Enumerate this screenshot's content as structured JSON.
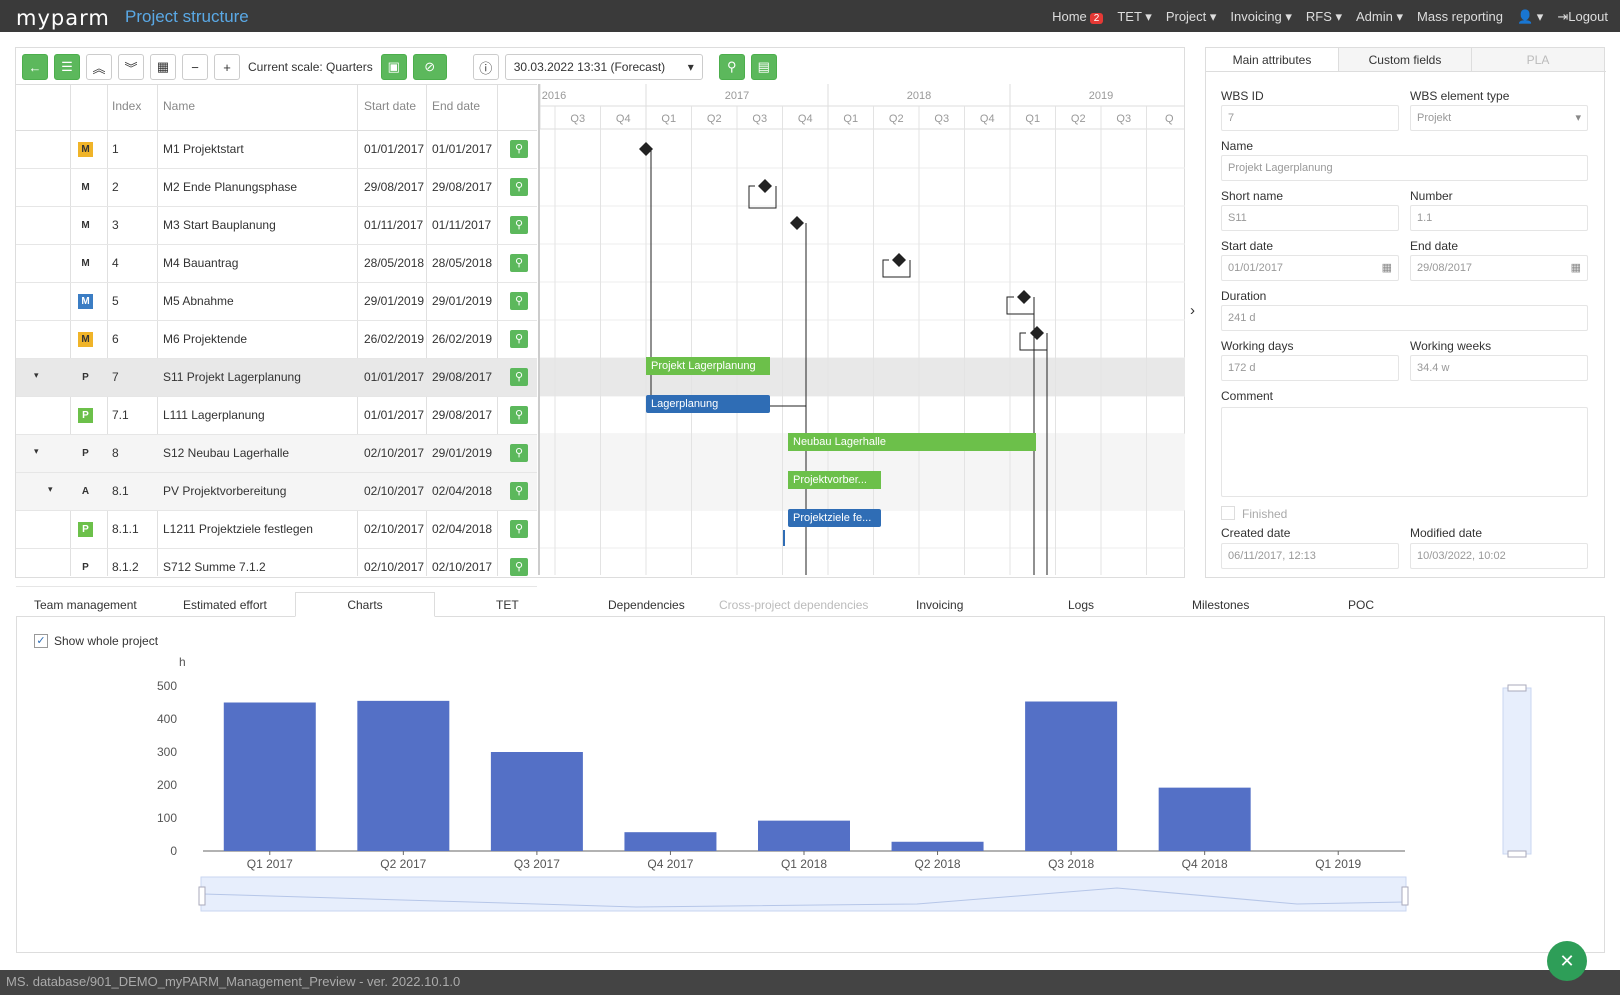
{
  "app": {
    "logo": "myparm",
    "title": "Project structure"
  },
  "nav": {
    "home": "Home",
    "home_badge": "2",
    "tet": "TET",
    "project": "Project",
    "invoicing": "Invoicing",
    "rfs": "RFS",
    "admin": "Admin",
    "mass_reporting": "Mass reporting",
    "logout": "Logout"
  },
  "toolbar": {
    "scale_label": "Current scale: Quarters",
    "forecast_value": "30.03.2022 13:31 (Forecast)"
  },
  "grid": {
    "headers": {
      "index": "Index",
      "name": "Name",
      "start": "Start date",
      "end": "End date"
    },
    "rows": [
      {
        "type": "M",
        "color": "y",
        "index": "1",
        "name": "M1 Projektstart",
        "start": "01/01/2017",
        "end": "01/01/2017",
        "expander": ""
      },
      {
        "type": "M",
        "color": "",
        "index": "2",
        "name": "M2 Ende Planungsphase",
        "start": "29/08/2017",
        "end": "29/08/2017",
        "expander": ""
      },
      {
        "type": "M",
        "color": "",
        "index": "3",
        "name": "M3 Start Bauplanung",
        "start": "01/11/2017",
        "end": "01/11/2017",
        "expander": ""
      },
      {
        "type": "M",
        "color": "",
        "index": "4",
        "name": "M4 Bauantrag",
        "start": "28/05/2018",
        "end": "28/05/2018",
        "expander": ""
      },
      {
        "type": "M",
        "color": "b",
        "index": "5",
        "name": "M5 Abnahme",
        "start": "29/01/2019",
        "end": "29/01/2019",
        "expander": ""
      },
      {
        "type": "M",
        "color": "y",
        "index": "6",
        "name": "M6 Projektende",
        "start": "26/02/2019",
        "end": "26/02/2019",
        "expander": ""
      },
      {
        "type": "P",
        "color": "",
        "index": "7",
        "name": "S11 Projekt Lagerplanung",
        "start": "01/01/2017",
        "end": "29/08/2017",
        "expander": "▾"
      },
      {
        "type": "P",
        "color": "g",
        "index": "7.1",
        "name": "L111 Lagerplanung",
        "start": "01/01/2017",
        "end": "29/08/2017",
        "expander": ""
      },
      {
        "type": "P",
        "color": "",
        "index": "8",
        "name": "S12 Neubau Lagerhalle",
        "start": "02/10/2017",
        "end": "29/01/2019",
        "expander": "▾"
      },
      {
        "type": "A",
        "color": "",
        "index": "8.1",
        "name": "PV Projektvorbereitung",
        "start": "02/10/2017",
        "end": "02/04/2018",
        "expander": "▾"
      },
      {
        "type": "P",
        "color": "g",
        "index": "8.1.1",
        "name": "L1211 Projektziele festlegen",
        "start": "02/10/2017",
        "end": "02/04/2018",
        "expander": ""
      },
      {
        "type": "P",
        "color": "",
        "index": "8.1.2",
        "name": "S712 Summe 7.1.2",
        "start": "02/10/2017",
        "end": "02/10/2017",
        "expander": ""
      }
    ]
  },
  "gantt": {
    "years": [
      "2016",
      "2017",
      "2018",
      "2019"
    ],
    "quarters": [
      "Q3",
      "Q4",
      "Q1",
      "Q2",
      "Q3",
      "Q4",
      "Q1",
      "Q2",
      "Q3",
      "Q4",
      "Q1",
      "Q2",
      "Q3",
      "Q"
    ],
    "bars": {
      "b1": "Projekt Lagerplanung",
      "b2": "Lagerplanung",
      "b3": "Neubau Lagerhalle",
      "b4": "Projektvorber...",
      "b5": "Projektziele fe..."
    }
  },
  "side": {
    "tabs": [
      "Main attributes",
      "Custom fields",
      "PLA"
    ],
    "wbs_id_label": "WBS ID",
    "wbs_id": "7",
    "type_label": "WBS element type",
    "type": "Projekt",
    "name_label": "Name",
    "name": "Projekt Lagerplanung",
    "short_label": "Short name",
    "short": "S11",
    "number_label": "Number",
    "number": "1.1",
    "start_label": "Start date",
    "start": "01/01/2017",
    "end_label": "End date",
    "end": "29/08/2017",
    "duration_label": "Duration",
    "duration": "241 d",
    "wdays_label": "Working days",
    "wdays": "172 d",
    "wweeks_label": "Working weeks",
    "wweeks": "34.4 w",
    "comment_label": "Comment",
    "finished_label": "Finished",
    "created_label": "Created date",
    "created": "06/11/2017, 12:13",
    "modified_label": "Modified date",
    "modified": "10/03/2022, 10:02"
  },
  "bottom_tabs": [
    "Team management",
    "Estimated effort",
    "Charts",
    "TET",
    "Dependencies",
    "Cross-project dependencies",
    "Invoicing",
    "Logs",
    "Milestones",
    "POC"
  ],
  "show_whole_label": "Show whole project",
  "status_text": "MS. database/901_DEMO_myPARM_Management_Preview - ver. 2022.10.1.0",
  "chart_data": {
    "type": "bar",
    "categories": [
      "Q1 2017",
      "Q2 2017",
      "Q3 2017",
      "Q4 2017",
      "Q1 2018",
      "Q2 2018",
      "Q3 2018",
      "Q4 2018",
      "Q1 2019"
    ],
    "values": [
      450,
      455,
      300,
      57,
      92,
      28,
      453,
      192,
      0
    ],
    "ylabel": "h",
    "yticks": [
      "0",
      "100",
      "200",
      "300",
      "400",
      "500"
    ],
    "ylim": [
      0,
      500
    ],
    "bar_color": "#5470c6"
  }
}
